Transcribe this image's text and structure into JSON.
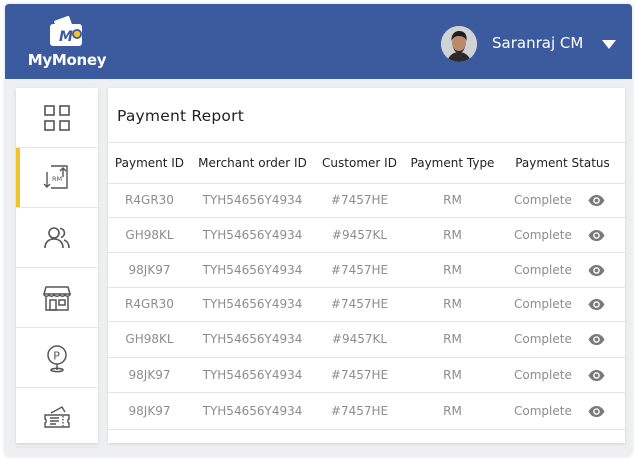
{
  "app": {
    "name": "MyMoney",
    "brand_color": "#3c5a9e",
    "accent_color": "#f3c32c"
  },
  "user": {
    "name": "Saranraj CM"
  },
  "sidebar": {
    "items": [
      {
        "icon": "grid-icon",
        "active": false
      },
      {
        "icon": "rm-exchange-icon",
        "label": "RM",
        "active": true
      },
      {
        "icon": "users-icon",
        "active": false
      },
      {
        "icon": "store-icon",
        "active": false
      },
      {
        "icon": "parking-location-icon",
        "label": "P",
        "active": false
      },
      {
        "icon": "tickets-icon",
        "active": false
      }
    ]
  },
  "report": {
    "title": "Payment Report",
    "columns": [
      "Payment ID",
      "Merchant order ID",
      "Customer ID",
      "Payment Type",
      "Payment Status"
    ],
    "rows": [
      [
        "R4GR30",
        "TYH54656Y4934",
        "#7457HE",
        "RM",
        "Complete"
      ],
      [
        "GH98KL",
        "TYH54656Y4934",
        "#9457KL",
        "RM",
        "Complete"
      ],
      [
        "98JK97",
        "TYH54656Y4934",
        "#7457HE",
        "RM",
        "Complete"
      ],
      [
        "R4GR30",
        "TYH54656Y4934",
        "#7457HE",
        "RM",
        "Complete"
      ],
      [
        "GH98KL",
        "TYH54656Y4934",
        "#9457KL",
        "RM",
        "Complete"
      ],
      [
        "98JK97",
        "TYH54656Y4934",
        "#7457HE",
        "RM",
        "Complete"
      ],
      [
        "98JK97",
        "TYH54656Y4934",
        "#7457HE",
        "RM",
        "Complete"
      ]
    ]
  }
}
